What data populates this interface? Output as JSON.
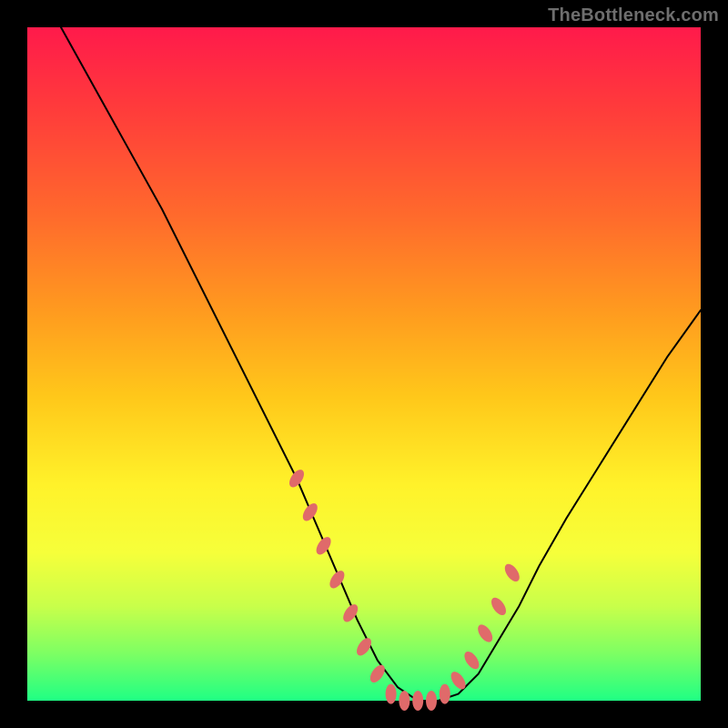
{
  "watermark": "TheBottleneck.com",
  "chart_data": {
    "type": "line",
    "title": "",
    "xlabel": "",
    "ylabel": "",
    "xlim": [
      0,
      100
    ],
    "ylim": [
      0,
      100
    ],
    "grid": false,
    "legend": false,
    "description": "Bottleneck percentage curve over a rainbow gradient (red high, green low). Black V-shaped curve; minimum (~0%) around x≈55–60. Salmon dotted markers along the lower flanks of the V.",
    "series": [
      {
        "name": "bottleneck-curve",
        "color": "#000000",
        "x": [
          5,
          10,
          15,
          20,
          25,
          30,
          35,
          40,
          43,
          46,
          49,
          52,
          55,
          58,
          61,
          64,
          67,
          70,
          73,
          76,
          80,
          85,
          90,
          95,
          100
        ],
        "values": [
          100,
          91,
          82,
          73,
          63,
          53,
          43,
          33,
          26,
          19,
          12,
          6,
          2,
          0,
          0,
          1,
          4,
          9,
          14,
          20,
          27,
          35,
          43,
          51,
          58
        ]
      }
    ],
    "markers": {
      "name": "highlight-dots",
      "color": "#e06a6a",
      "x": [
        40,
        42,
        44,
        46,
        48,
        50,
        52,
        54,
        56,
        58,
        60,
        62,
        64,
        66,
        68,
        70,
        72
      ],
      "values": [
        33,
        28,
        23,
        18,
        13,
        8,
        4,
        1,
        0,
        0,
        0,
        1,
        3,
        6,
        10,
        14,
        19
      ]
    }
  }
}
